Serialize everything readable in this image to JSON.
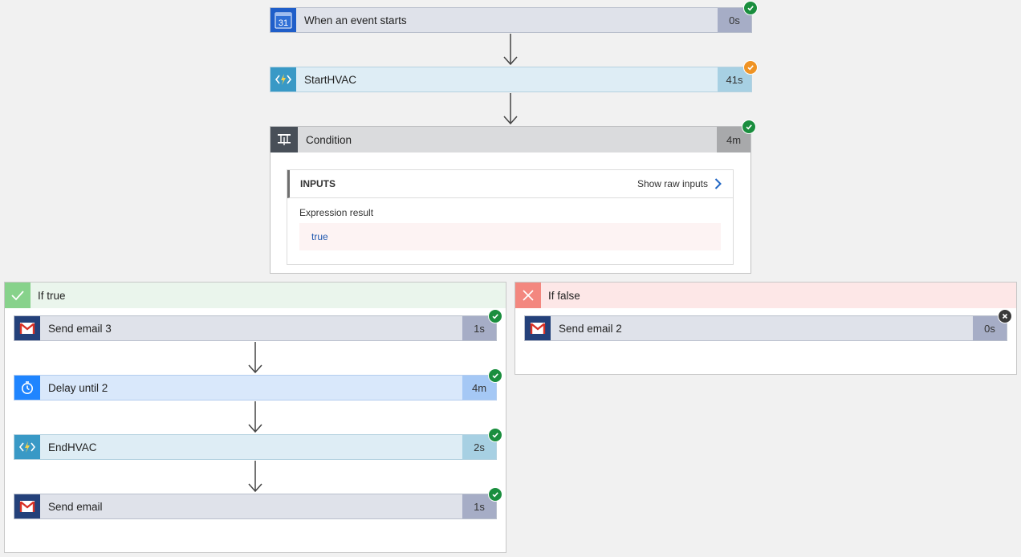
{
  "trigger": {
    "label": "When an event starts",
    "duration": "0s",
    "calendar_day": "31",
    "status": "succeeded"
  },
  "start_hvac": {
    "label": "StartHVAC",
    "duration": "41s",
    "status": "succeeded-with-retries"
  },
  "condition": {
    "label": "Condition",
    "duration": "4m",
    "status": "succeeded",
    "inputs_title": "INPUTS",
    "show_raw_label": "Show raw inputs",
    "expression_label": "Expression result",
    "expression_value": "true"
  },
  "if_true": {
    "title": "If true",
    "steps": [
      {
        "label": "Send email 3",
        "duration": "1s",
        "icon": "gmail-icon",
        "status": "succeeded"
      },
      {
        "label": "Delay until 2",
        "duration": "4m",
        "icon": "timer-icon",
        "status": "succeeded"
      },
      {
        "label": "EndHVAC",
        "duration": "2s",
        "icon": "function-icon",
        "status": "succeeded"
      },
      {
        "label": "Send email",
        "duration": "1s",
        "icon": "gmail-icon",
        "status": "succeeded"
      }
    ]
  },
  "if_false": {
    "title": "If false",
    "steps": [
      {
        "label": "Send email 2",
        "duration": "0s",
        "icon": "gmail-icon",
        "status": "cancelled"
      }
    ]
  },
  "colors": {
    "success": "#1a8e3e",
    "warning": "#ef9324",
    "cancelled": "#3a3a3a",
    "true_branch": "#87d28b",
    "false_branch": "#f3877f"
  }
}
